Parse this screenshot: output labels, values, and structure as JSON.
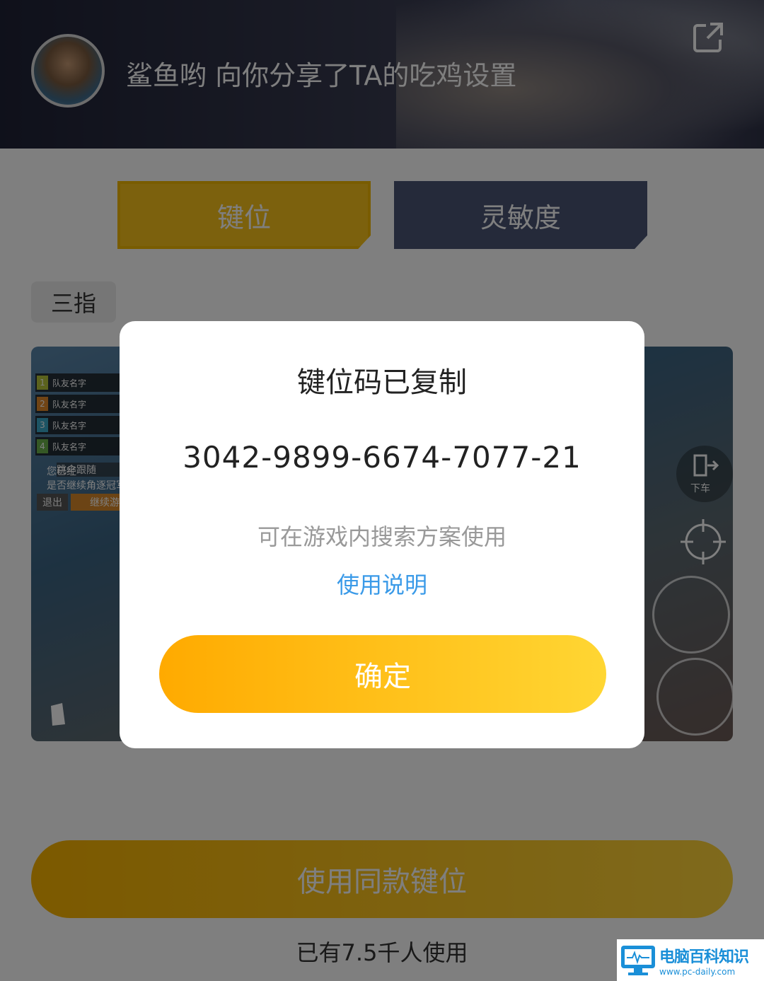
{
  "header": {
    "title": "鲨鱼哟 向你分享了TA的吃鸡设置"
  },
  "tabs": [
    {
      "label": "键位"
    },
    {
      "label": "灵敏度"
    }
  ],
  "mode_chip": "三指",
  "preview": {
    "teammates": [
      {
        "num": "1",
        "label": "队友名字"
      },
      {
        "num": "2",
        "label": "队友名字"
      },
      {
        "num": "3",
        "label": "队友名字"
      },
      {
        "num": "4",
        "label": "队友名字"
      }
    ],
    "follow_label": "跳伞跟随",
    "msg_line1": "您已经",
    "msg_line2": "是否继续角逐冠军",
    "exit_label": "退出",
    "continue_label": "继续游戏",
    "exit_vehicle_label": "下车"
  },
  "use_button": "使用同款键位",
  "users_count": "已有7.5千人使用",
  "watermark": {
    "name": "电脑百科知识",
    "url": "www.pc-daily.com"
  },
  "dialog": {
    "title": "键位码已复制",
    "code": "3042-9899-6674-7077-21",
    "hint": "可在游戏内搜索方案使用",
    "help_link": "使用说明",
    "confirm": "确定"
  }
}
